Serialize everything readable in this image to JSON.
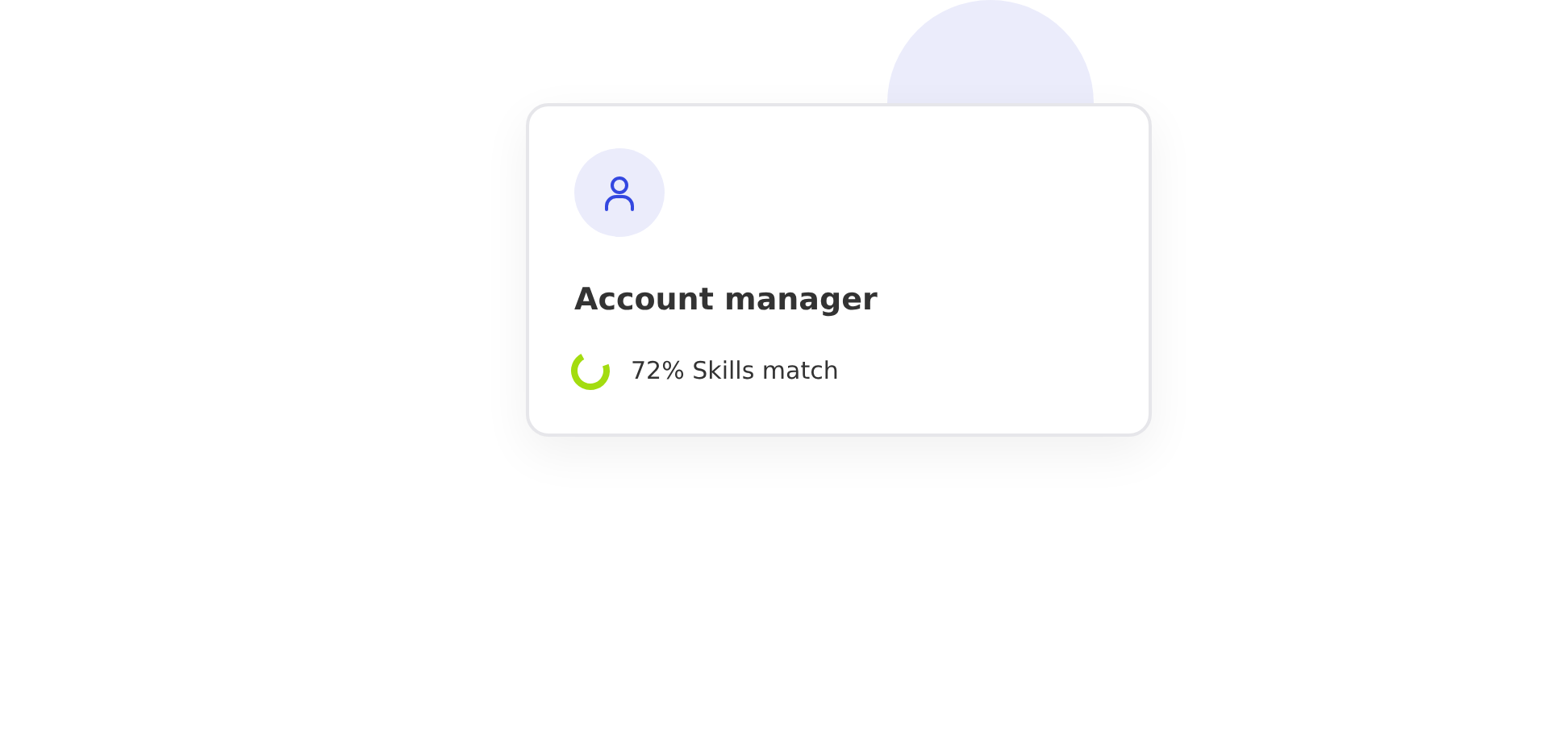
{
  "card": {
    "title": "Account manager",
    "match": {
      "level": 0.72,
      "text": "72% Skills match"
    }
  }
}
